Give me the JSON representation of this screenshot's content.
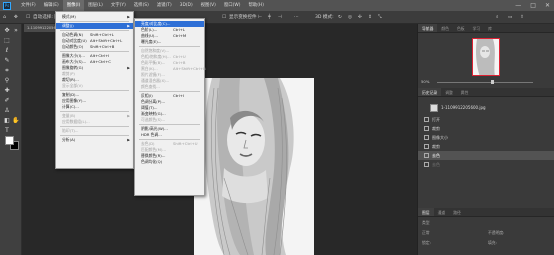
{
  "menubar": {
    "logo": "Ps",
    "items": [
      "文件(F)",
      "编辑(E)",
      "图像(I)",
      "图层(L)",
      "文字(Y)",
      "选择(S)",
      "滤镜(T)",
      "3D(D)",
      "视图(V)",
      "窗口(W)",
      "帮助(H)"
    ],
    "active_index": 2,
    "window_controls": [
      "—",
      "□",
      "✕"
    ]
  },
  "options_bar": {
    "auto_select_label": "自动选择:",
    "auto_select_value": "图层",
    "transform_label": "显示变换控件",
    "mode_3d_label": "3D 模式:"
  },
  "document_tab": {
    "title": "1-1109912205600.jpg"
  },
  "image_menu": {
    "items": [
      {
        "label": "模式(M)",
        "shortcut": "",
        "submenu": true,
        "enabled": true
      },
      {
        "sep": true
      },
      {
        "label": "调整(J)",
        "shortcut": "",
        "submenu": true,
        "enabled": true,
        "highlighted": true
      },
      {
        "sep": true
      },
      {
        "label": "自动色调(N)",
        "shortcut": "Shift+Ctrl+L",
        "enabled": true
      },
      {
        "label": "自动对比度(U)",
        "shortcut": "Alt+Shift+Ctrl+L",
        "enabled": true
      },
      {
        "label": "自动颜色(O)",
        "shortcut": "Shift+Ctrl+B",
        "enabled": true
      },
      {
        "sep": true
      },
      {
        "label": "图像大小(I)...",
        "shortcut": "Alt+Ctrl+I",
        "enabled": true
      },
      {
        "label": "画布大小(S)...",
        "shortcut": "Alt+Ctrl+C",
        "enabled": true
      },
      {
        "label": "图像旋转(G)",
        "shortcut": "",
        "submenu": true,
        "enabled": true
      },
      {
        "label": "裁剪(P)",
        "shortcut": "",
        "enabled": false
      },
      {
        "label": "裁切(R)...",
        "shortcut": "",
        "enabled": true
      },
      {
        "label": "显示全部(V)",
        "shortcut": "",
        "enabled": false
      },
      {
        "sep": true
      },
      {
        "label": "复制(D)...",
        "shortcut": "",
        "enabled": true
      },
      {
        "label": "应用图像(Y)...",
        "shortcut": "",
        "enabled": true
      },
      {
        "label": "计算(C)...",
        "shortcut": "",
        "enabled": true
      },
      {
        "sep": true
      },
      {
        "label": "变量(B)",
        "shortcut": "",
        "submenu": true,
        "enabled": false
      },
      {
        "label": "应用数据组(L)...",
        "shortcut": "",
        "enabled": false
      },
      {
        "sep": true
      },
      {
        "label": "陷印(T)...",
        "shortcut": "",
        "enabled": false
      },
      {
        "sep": true
      },
      {
        "label": "分析(A)",
        "shortcut": "",
        "submenu": true,
        "enabled": true
      }
    ]
  },
  "adjust_menu": {
    "items": [
      {
        "label": "亮度/对比度(C)...",
        "shortcut": "",
        "enabled": true,
        "highlighted": true
      },
      {
        "label": "色阶(L)...",
        "shortcut": "Ctrl+L",
        "enabled": true
      },
      {
        "label": "曲线(U)...",
        "shortcut": "Ctrl+M",
        "enabled": true
      },
      {
        "label": "曝光度(E)...",
        "shortcut": "",
        "enabled": true
      },
      {
        "sep": true
      },
      {
        "label": "自然饱和度(V)...",
        "shortcut": "",
        "enabled": false
      },
      {
        "label": "色相/饱和度(H)...",
        "shortcut": "Ctrl+U",
        "enabled": false
      },
      {
        "label": "色彩平衡(B)...",
        "shortcut": "Ctrl+B",
        "enabled": false
      },
      {
        "label": "黑白(K)...",
        "shortcut": "Alt+Shift+Ctrl+B",
        "enabled": false
      },
      {
        "label": "照片滤镜(F)...",
        "shortcut": "",
        "enabled": false
      },
      {
        "label": "通道混合器(X)...",
        "shortcut": "",
        "enabled": false
      },
      {
        "label": "颜色查找...",
        "shortcut": "",
        "enabled": false
      },
      {
        "sep": true
      },
      {
        "label": "反相(I)",
        "shortcut": "Ctrl+I",
        "enabled": true
      },
      {
        "label": "色调分离(P)...",
        "shortcut": "",
        "enabled": true
      },
      {
        "label": "阈值(T)...",
        "shortcut": "",
        "enabled": true
      },
      {
        "label": "渐变映射(G)...",
        "shortcut": "",
        "enabled": true
      },
      {
        "label": "可选颜色(S)...",
        "shortcut": "",
        "enabled": false
      },
      {
        "sep": true
      },
      {
        "label": "阴影/高光(W)...",
        "shortcut": "",
        "enabled": true
      },
      {
        "label": "HDR 色调...",
        "shortcut": "",
        "enabled": true
      },
      {
        "sep": true
      },
      {
        "label": "去色(D)",
        "shortcut": "Shift+Ctrl+U",
        "enabled": false
      },
      {
        "label": "匹配颜色(M)...",
        "shortcut": "",
        "enabled": false
      },
      {
        "label": "替换颜色(R)...",
        "shortcut": "",
        "enabled": true
      },
      {
        "label": "色调均化(Q)",
        "shortcut": "",
        "enabled": true
      }
    ]
  },
  "navigator_panel": {
    "tabs": [
      "导航器",
      "颜色",
      "色板",
      "学习",
      "库"
    ],
    "zoom": "50%"
  },
  "history_panel": {
    "tabs": [
      "历史记录",
      "调整",
      "属性"
    ],
    "document": "1-1109912205600.jpg",
    "items": [
      {
        "label": "打开",
        "state": "normal"
      },
      {
        "label": "裁剪",
        "state": "normal"
      },
      {
        "label": "图像大小",
        "state": "normal"
      },
      {
        "label": "裁剪",
        "state": "normal"
      },
      {
        "label": "去色",
        "state": "selected"
      },
      {
        "label": "去色",
        "state": "dim"
      }
    ]
  },
  "layers_panel": {
    "tabs": [
      "图层",
      "通道",
      "路径"
    ],
    "kind_label": "类型",
    "blend_label": "正常",
    "opacity_label": "不透明度:",
    "lock_label": "锁定:",
    "fill_label": "填充:"
  },
  "colors": {
    "menubar": "#535353",
    "highlight": "#2e6fd6",
    "panel": "#3a3a3a"
  }
}
